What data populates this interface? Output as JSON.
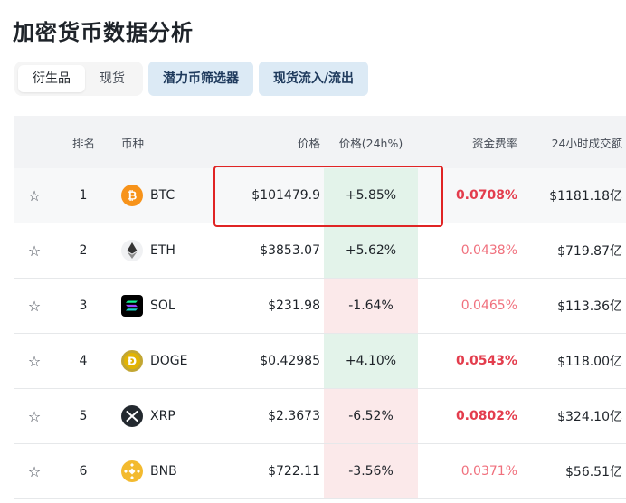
{
  "page": {
    "title": "加密货币数据分析"
  },
  "tabs": {
    "derivatives": "衍生品",
    "spot": "现货"
  },
  "buttons": {
    "screener": "潜力币筛选器",
    "spot_flow": "现货流入/流出"
  },
  "table": {
    "headers": {
      "rank": "排名",
      "coin": "币种",
      "price": "价格",
      "change": "价格(24h%)",
      "funding": "资金费率",
      "volume": "24小时成交额"
    },
    "rows": [
      {
        "rank": "1",
        "symbol": "BTC",
        "icon": "bitcoin-icon",
        "price": "$101479.9",
        "change": "+5.85%",
        "direction": "up",
        "funding": "0.0708%",
        "funding_style": "strong",
        "volume": "$1181.18亿"
      },
      {
        "rank": "2",
        "symbol": "ETH",
        "icon": "ethereum-icon",
        "price": "$3853.07",
        "change": "+5.62%",
        "direction": "up",
        "funding": "0.0438%",
        "funding_style": "light",
        "volume": "$719.87亿"
      },
      {
        "rank": "3",
        "symbol": "SOL",
        "icon": "solana-icon",
        "price": "$231.98",
        "change": "-1.64%",
        "direction": "down",
        "funding": "0.0465%",
        "funding_style": "light",
        "volume": "$113.36亿"
      },
      {
        "rank": "4",
        "symbol": "DOGE",
        "icon": "dogecoin-icon",
        "price": "$0.42985",
        "change": "+4.10%",
        "direction": "up",
        "funding": "0.0543%",
        "funding_style": "strong",
        "volume": "$118.00亿"
      },
      {
        "rank": "5",
        "symbol": "XRP",
        "icon": "xrp-icon",
        "price": "$2.3673",
        "change": "-6.52%",
        "direction": "down",
        "funding": "0.0802%",
        "funding_style": "strong",
        "volume": "$324.10亿"
      },
      {
        "rank": "6",
        "symbol": "BNB",
        "icon": "bnb-icon",
        "price": "$722.11",
        "change": "-3.56%",
        "direction": "down",
        "funding": "0.0371%",
        "funding_style": "light",
        "volume": "$56.51亿"
      }
    ]
  },
  "colors": {
    "up_bg": "#e3f3ea",
    "down_bg": "#fbe9ea",
    "funding_red": "#e33d4d",
    "highlight_border": "#e02424",
    "button_bg": "#dceaf5"
  }
}
